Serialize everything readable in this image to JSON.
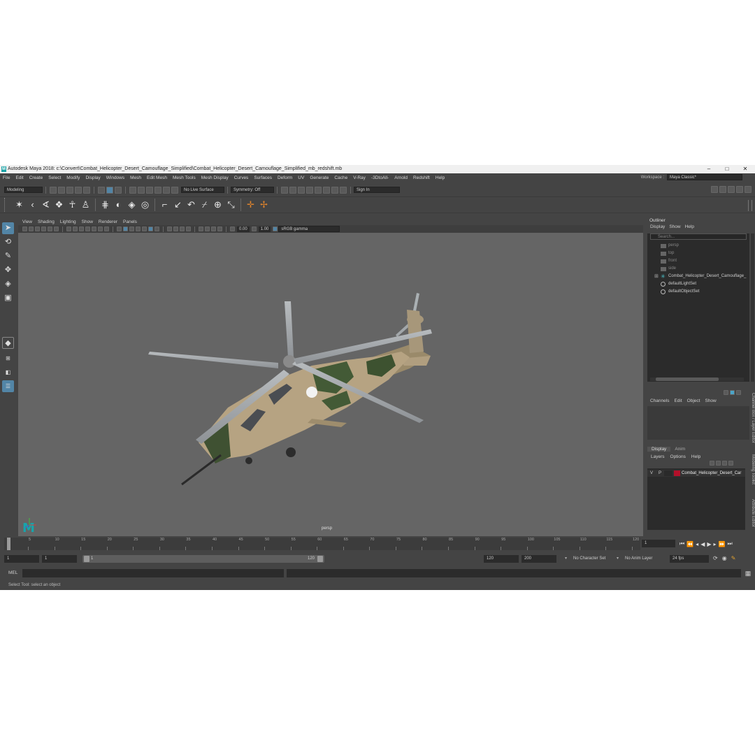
{
  "window": {
    "title": "Autodesk Maya 2018: c:\\Convert\\Combat_Helicopter_Desert_Camouflage_Simplified\\Combat_Helicopter_Desert_Camouflage_Simplified_mb_redshift.mb",
    "logo": "M",
    "min": "–",
    "max": "□",
    "close": "✕"
  },
  "menubar": {
    "items": [
      "File",
      "Edit",
      "Create",
      "Select",
      "Modify",
      "Display",
      "Windows",
      "Mesh",
      "Edit Mesh",
      "Mesh Tools",
      "Mesh Display",
      "Curves",
      "Surfaces",
      "Deform",
      "UV",
      "Generate",
      "Cache",
      "V-Ray",
      "-3DtoAll-",
      "Arnold",
      "Redshift",
      "Help"
    ],
    "workspace_label": "Workspace :",
    "workspace_value": "Maya Classic*"
  },
  "statusline": {
    "mode": "Modeling",
    "live_surface": "No Live Surface",
    "symmetry": "Symmetry: Off",
    "sign_in": "Sign In"
  },
  "viewport": {
    "menu": [
      "View",
      "Shading",
      "Lighting",
      "Show",
      "Renderer",
      "Panels"
    ],
    "exposure": "0.00",
    "gamma": "1.00",
    "color_space": "sRGB gamma",
    "camera_label": "persp"
  },
  "outliner": {
    "title": "Outliner",
    "menu": [
      "Display",
      "Show",
      "Help"
    ],
    "search_placeholder": "Search...",
    "items": [
      {
        "label": "persp",
        "dim": true
      },
      {
        "label": "top",
        "dim": true
      },
      {
        "label": "front",
        "dim": true
      },
      {
        "label": "side",
        "dim": true
      },
      {
        "label": "Combat_Helicopter_Desert_Camouflage_",
        "dim": false
      },
      {
        "label": "defaultLightSet",
        "dim": false
      },
      {
        "label": "defaultObjectSet",
        "dim": false
      }
    ]
  },
  "channelbox": {
    "menu": [
      "Channels",
      "Edit",
      "Object",
      "Show"
    ]
  },
  "layereditor": {
    "tabs": [
      "Display",
      "Anim"
    ],
    "menu": [
      "Layers",
      "Options",
      "Help"
    ],
    "layer": {
      "v": "V",
      "p": "P",
      "name": "Combat_Helicopter_Desert_Car",
      "color": "#b3102a"
    }
  },
  "sidetabs": [
    "Channel Box / Layer Editor",
    "Modeling Toolkit",
    "Attribute Editor"
  ],
  "timeslider": {
    "ticks": [
      "1",
      "5",
      "10",
      "15",
      "20",
      "25",
      "30",
      "35",
      "40",
      "45",
      "50",
      "55",
      "60",
      "65",
      "70",
      "75",
      "80",
      "85",
      "90",
      "95",
      "100",
      "105",
      "110",
      "115",
      "120"
    ],
    "current_frame": "1"
  },
  "range": {
    "start": "1",
    "start_inner": "1",
    "slider_start": "1",
    "slider_end": "120",
    "end_inner": "120",
    "end": "200",
    "character_set": "No Character Set",
    "anim_layer": "No Anim Layer",
    "fps": "24 fps"
  },
  "commandline": {
    "label": "MEL"
  },
  "helpline": {
    "text": "Select Tool: select an object"
  },
  "colors": {
    "ui_bg": "#444444",
    "viewport_bg": "#656565",
    "accent": "#5285a6",
    "maya_teal": "#1aa2a6"
  }
}
